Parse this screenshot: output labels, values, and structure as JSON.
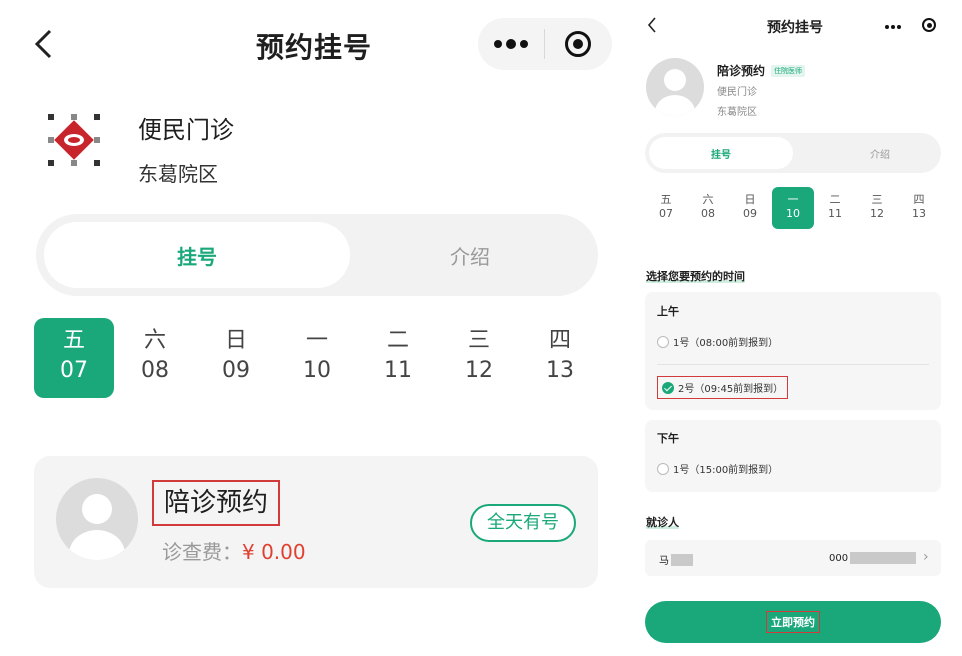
{
  "left": {
    "title": "预约挂号",
    "clinic": "便民门诊",
    "hospital": "东葛院区",
    "tabs": [
      "挂号",
      "介绍"
    ],
    "days": [
      {
        "weekday": "五",
        "date": "07"
      },
      {
        "weekday": "六",
        "date": "08"
      },
      {
        "weekday": "日",
        "date": "09"
      },
      {
        "weekday": "一",
        "date": "10"
      },
      {
        "weekday": "二",
        "date": "11"
      },
      {
        "weekday": "三",
        "date": "12"
      },
      {
        "weekday": "四",
        "date": "13"
      }
    ],
    "selected_day": "07",
    "doctor": {
      "name": "陪诊预约",
      "fee_label": "诊查费：",
      "fee_value": "¥ 0.00",
      "availability": "全天有号"
    }
  },
  "right": {
    "title": "预约挂号",
    "doctor_name": "陪诊预约",
    "doctor_tag": "住院医师",
    "clinic": "便民门诊",
    "hospital": "东葛院区",
    "tabs": [
      "挂号",
      "介绍"
    ],
    "days": [
      {
        "weekday": "五",
        "date": "07"
      },
      {
        "weekday": "六",
        "date": "08"
      },
      {
        "weekday": "日",
        "date": "09"
      },
      {
        "weekday": "一",
        "date": "10"
      },
      {
        "weekday": "二",
        "date": "11"
      },
      {
        "weekday": "三",
        "date": "12"
      },
      {
        "weekday": "四",
        "date": "13"
      }
    ],
    "selected_day": "10",
    "time_section_title": "选择您要预约的时间",
    "morning": {
      "label": "上午",
      "slots": [
        "1号（08:00前到报到）",
        "2号（09:45前到报到）"
      ],
      "selected": "2号（09:45前到报到）"
    },
    "afternoon": {
      "label": "下午",
      "slots": [
        "1号（15:00前到报到）"
      ]
    },
    "patient_section_title": "就诊人",
    "patient_name_prefix": "马",
    "patient_id_prefix": "000",
    "book_button": "立即预约"
  },
  "colors": {
    "accent": "#1aa87a",
    "highlight_box": "#d23b3b",
    "price": "#e0402f"
  }
}
